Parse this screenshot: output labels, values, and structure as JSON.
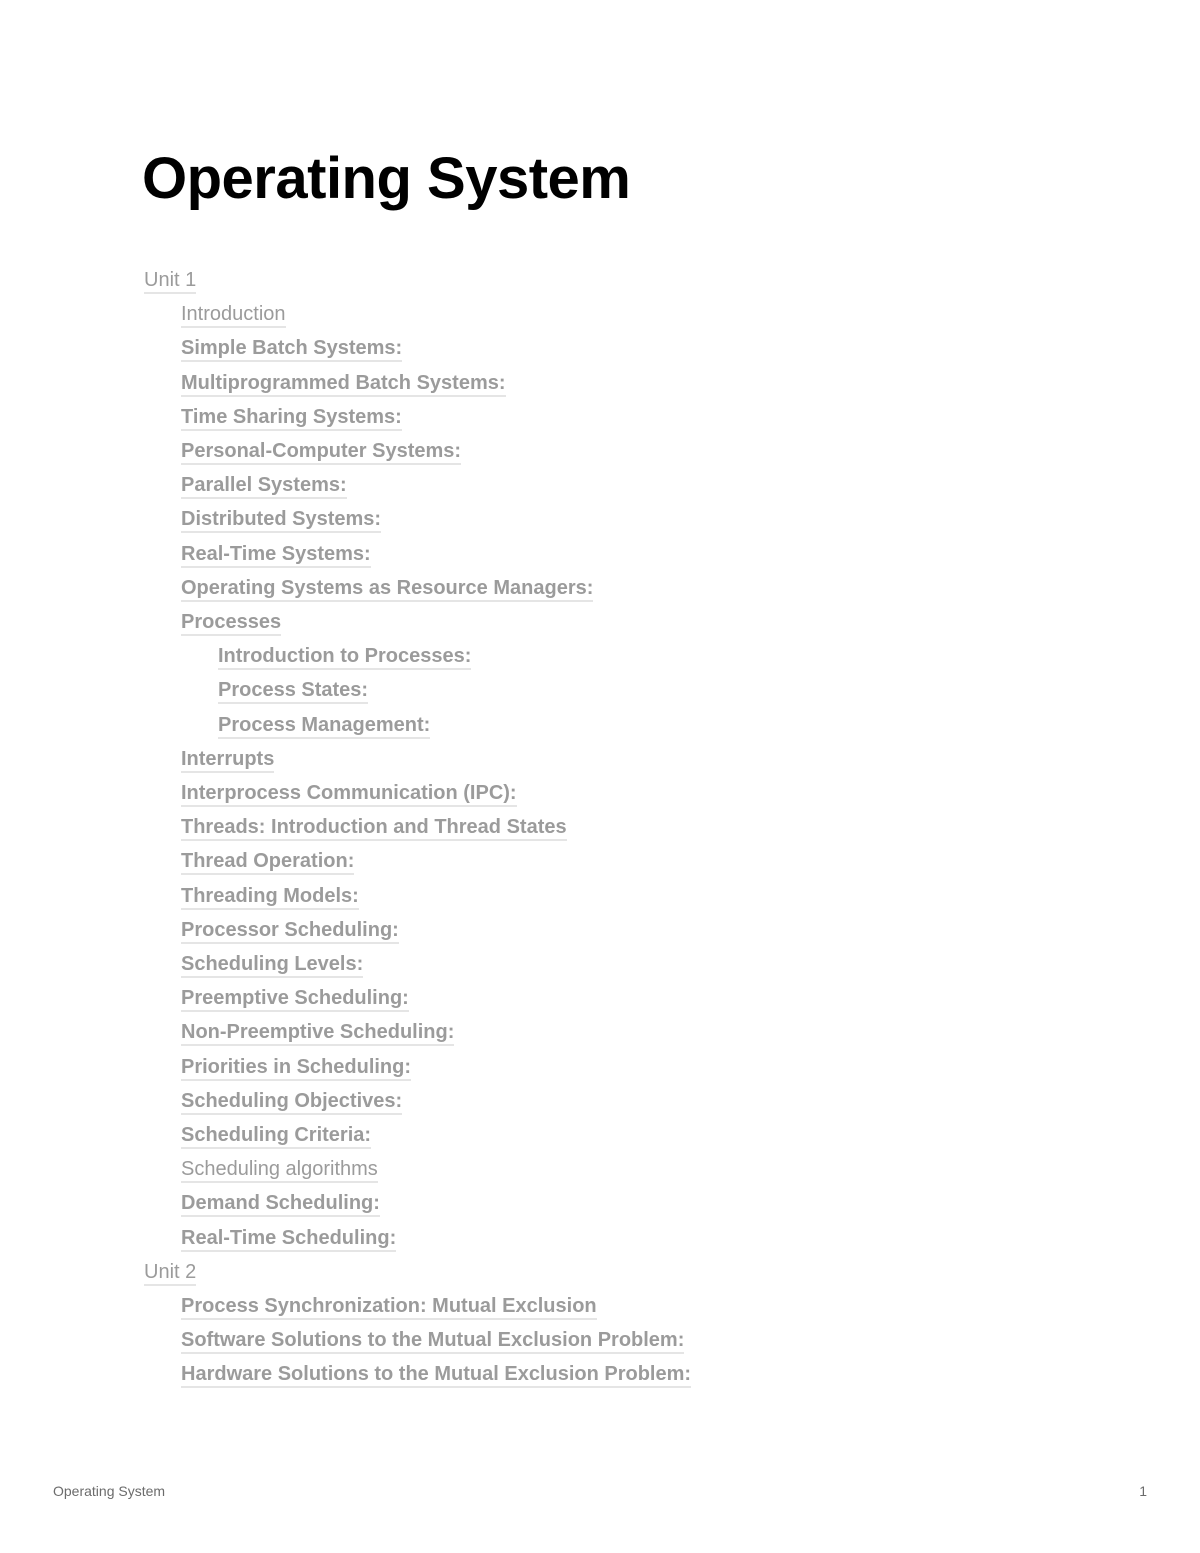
{
  "title": "Operating System",
  "toc": [
    {
      "label": "Unit 1",
      "level": 0,
      "bold": false
    },
    {
      "label": "Introduction",
      "level": 1,
      "bold": false
    },
    {
      "label": "Simple Batch Systems:",
      "level": 1,
      "bold": true
    },
    {
      "label": "Multiprogrammed Batch Systems:",
      "level": 1,
      "bold": true
    },
    {
      "label": "Time Sharing Systems:",
      "level": 1,
      "bold": true
    },
    {
      "label": "Personal-Computer Systems:",
      "level": 1,
      "bold": true
    },
    {
      "label": "Parallel Systems:",
      "level": 1,
      "bold": true
    },
    {
      "label": "Distributed Systems:",
      "level": 1,
      "bold": true
    },
    {
      "label": "Real-Time Systems:",
      "level": 1,
      "bold": true
    },
    {
      "label": "Operating Systems as Resource Managers:",
      "level": 1,
      "bold": true
    },
    {
      "label": "Processes",
      "level": 1,
      "bold": true
    },
    {
      "label": "Introduction to Processes:",
      "level": 2,
      "bold": true
    },
    {
      "label": "Process States:",
      "level": 2,
      "bold": true
    },
    {
      "label": "Process Management:",
      "level": 2,
      "bold": true
    },
    {
      "label": "Interrupts",
      "level": 1,
      "bold": true
    },
    {
      "label": "Interprocess Communication (IPC):",
      "level": 1,
      "bold": true
    },
    {
      "label": "Threads: Introduction and Thread States",
      "level": 1,
      "bold": true
    },
    {
      "label": "Thread Operation:",
      "level": 1,
      "bold": true
    },
    {
      "label": "Threading Models:",
      "level": 1,
      "bold": true
    },
    {
      "label": "Processor Scheduling:",
      "level": 1,
      "bold": true
    },
    {
      "label": "Scheduling Levels:",
      "level": 1,
      "bold": true
    },
    {
      "label": "Preemptive Scheduling:",
      "level": 1,
      "bold": true
    },
    {
      "label": "Non-Preemptive Scheduling:",
      "level": 1,
      "bold": true
    },
    {
      "label": "Priorities in Scheduling:",
      "level": 1,
      "bold": true
    },
    {
      "label": "Scheduling Objectives:",
      "level": 1,
      "bold": true
    },
    {
      "label": "Scheduling Criteria:",
      "level": 1,
      "bold": true
    },
    {
      "label": "Scheduling algorithms",
      "level": 1,
      "bold": false
    },
    {
      "label": "Demand Scheduling:",
      "level": 1,
      "bold": true
    },
    {
      "label": "Real-Time Scheduling:",
      "level": 1,
      "bold": true
    },
    {
      "label": "Unit 2",
      "level": 0,
      "bold": false
    },
    {
      "label": "Process Synchronization: Mutual Exclusion",
      "level": 1,
      "bold": true
    },
    {
      "label": "Software Solutions to the Mutual Exclusion Problem:",
      "level": 1,
      "bold": true
    },
    {
      "label": "Hardware Solutions to the Mutual Exclusion Problem:",
      "level": 1,
      "bold": true
    }
  ],
  "footer": {
    "left": "Operating System",
    "page_number": "1"
  }
}
